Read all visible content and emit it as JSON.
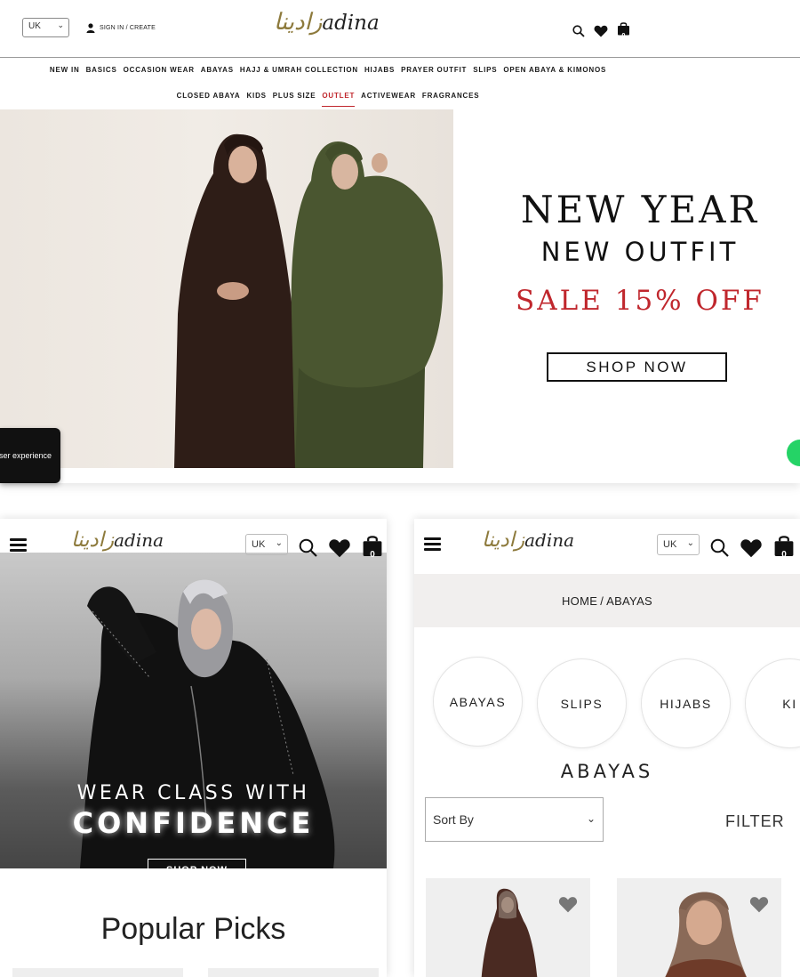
{
  "desktop": {
    "currency": "UK",
    "signin_label": "SIGN IN / CREATE",
    "logo_arabic": "زادينا",
    "logo_latin": "adina",
    "cart_count": "0",
    "nav_row1": [
      "NEW IN",
      "BASICS",
      "OCCASION WEAR",
      "ABAYAS",
      "HAJJ & UMRAH COLLECTION",
      "HIJABS",
      "PRAYER OUTFIT",
      "SLIPS",
      "OPEN ABAYA & KIMONOS"
    ],
    "nav_row2": [
      "CLOSED ABAYA",
      "KIDS",
      "PLUS SIZE",
      "OUTLET",
      "ACTIVEWEAR",
      "FRAGRANCES"
    ],
    "hero": {
      "line1": "NEW YEAR",
      "line2": "NEW OUTFIT",
      "line3": "SALE 15% OFF",
      "button": "SHOP NOW"
    },
    "cookie_text": "user experience"
  },
  "mobile_home": {
    "currency": "UK",
    "logo_arabic": "زادينا",
    "logo_latin": "adina",
    "cart_count": "0",
    "hero_line1": "WEAR CLASS WITH",
    "hero_line2": "CONFIDENCE",
    "hero_button": "SHOP NOW",
    "section_title": "Popular Picks"
  },
  "mobile_abayas": {
    "currency": "UK",
    "logo_arabic": "زادينا",
    "logo_latin": "adina",
    "cart_count": "0",
    "breadcrumb": [
      "HOME",
      "ABAYAS"
    ],
    "categories": [
      "ABAYAS",
      "SLIPS",
      "HIJABS",
      "KI"
    ],
    "page_title": "ABAYAS",
    "sort_label": "Sort By",
    "filter_label": "FILTER"
  },
  "colors": {
    "accent_red": "#c0272d",
    "logo_gold": "#8d7a3c",
    "text_dark": "#111111"
  }
}
